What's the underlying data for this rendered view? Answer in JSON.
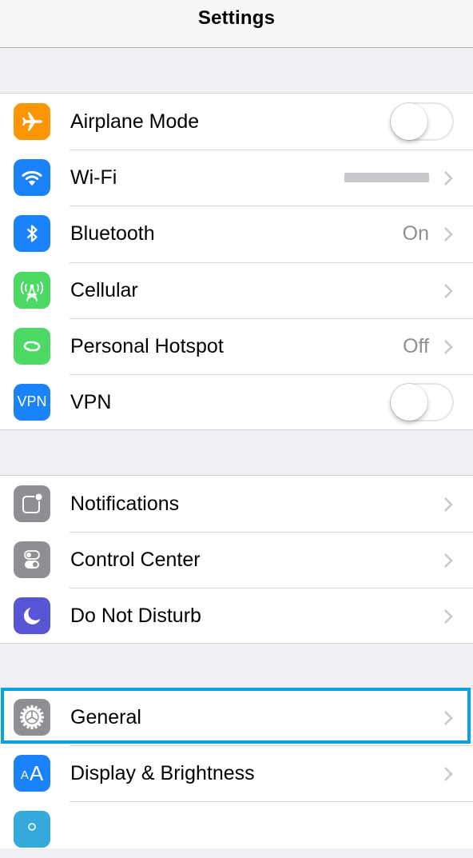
{
  "header": {
    "title": "Settings"
  },
  "sections": [
    {
      "rows": [
        {
          "label": "Airplane Mode",
          "icon": "airplane-icon",
          "icon_color": "#FF9500",
          "accessory": "toggle",
          "toggle_on": false
        },
        {
          "label": "Wi-Fi",
          "icon": "wifi-icon",
          "icon_color": "#1A82FB",
          "accessory": "chevron",
          "value": "(redacted network name)",
          "value_redacted": true
        },
        {
          "label": "Bluetooth",
          "icon": "bluetooth-icon",
          "icon_color": "#1A82FB",
          "accessory": "chevron",
          "value": "On"
        },
        {
          "label": "Cellular",
          "icon": "cellular-antenna-icon",
          "icon_color": "#4CD964",
          "accessory": "chevron"
        },
        {
          "label": "Personal Hotspot",
          "icon": "hotspot-link-icon",
          "icon_color": "#4CD964",
          "accessory": "chevron",
          "value": "Off"
        },
        {
          "label": "VPN",
          "icon": "vpn-icon",
          "icon_text": "VPN",
          "icon_color": "#1A82FB",
          "accessory": "toggle",
          "toggle_on": false
        }
      ]
    },
    {
      "rows": [
        {
          "label": "Notifications",
          "icon": "notifications-icon",
          "icon_color": "#8E8E93",
          "accessory": "chevron"
        },
        {
          "label": "Control Center",
          "icon": "control-center-icon",
          "icon_color": "#8E8E93",
          "accessory": "chevron"
        },
        {
          "label": "Do Not Disturb",
          "icon": "moon-icon",
          "icon_color": "#5856D6",
          "accessory": "chevron"
        }
      ]
    },
    {
      "rows": [
        {
          "label": "General",
          "icon": "gear-icon",
          "icon_color": "#8E8E93",
          "accessory": "chevron",
          "highlighted": true
        },
        {
          "label": "Display & Brightness",
          "icon": "text-size-icon",
          "icon_text": "AA",
          "icon_color": "#1A82FB",
          "accessory": "chevron"
        },
        {
          "label": "",
          "icon": "wallpaper-icon",
          "icon_color": "#34AADC",
          "accessory": "none"
        }
      ]
    }
  ],
  "highlight_color": "#0AA0E6"
}
